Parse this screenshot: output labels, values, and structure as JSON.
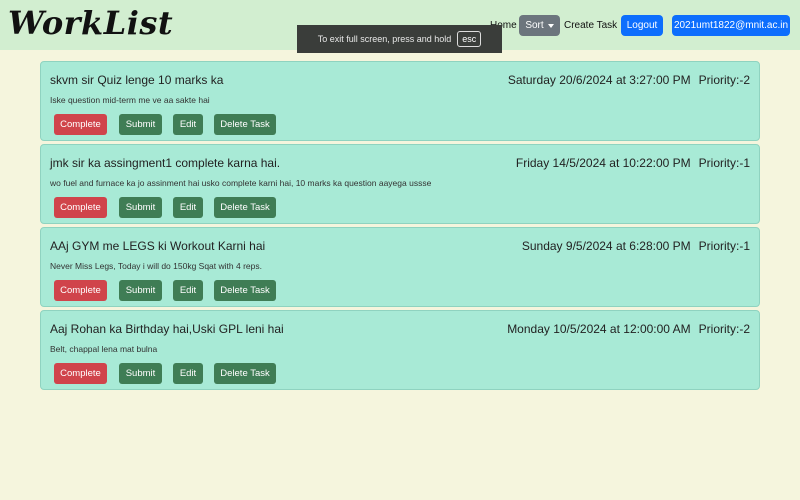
{
  "navbar": {
    "brand": "WorkList",
    "home": "Home",
    "sort": "Sort",
    "create_task": "Create Task",
    "logout": "Logout",
    "user_email": "2021umt1822@mnit.ac.in"
  },
  "fullscreen_notice": {
    "text": "To exit full screen, press and hold",
    "key": "esc"
  },
  "buttons": {
    "complete": "Complete",
    "submit": "Submit",
    "edit": "Edit",
    "delete": "Delete Task"
  },
  "tasks": [
    {
      "title": "skvm sir Quiz lenge 10 marks ka",
      "datetime": "Saturday 20/6/2024 at 3:27:00 PM",
      "priority": "Priority:-2",
      "description": "Iske question mid-term me ve aa sakte hai"
    },
    {
      "title": "jmk sir ka assingment1 complete karna hai.",
      "datetime": "Friday 14/5/2024 at 10:22:00 PM",
      "priority": "Priority:-1",
      "description": "wo fuel and furnace ka jo assinment hai usko complete karni hai, 10 marks ka question aayega ussse"
    },
    {
      "title": "AAj GYM me LEGS ki Workout Karni hai",
      "datetime": "Sunday 9/5/2024 at 6:28:00 PM",
      "priority": "Priority:-1",
      "description": "Never Miss Legs, Today i will do 150kg Sqat with 4 reps."
    },
    {
      "title": "Aaj Rohan ka Birthday hai,Uski GPL leni hai",
      "datetime": "Monday 10/5/2024 at 12:00:00 AM",
      "priority": "Priority:-2",
      "description": "Belt, chappal lena mat bulna"
    }
  ],
  "colors": {
    "page_bg": "#f5f5dd",
    "navbar_bg": "#d2eed0",
    "card_bg": "#a8ead6",
    "complete": "#d0444b",
    "action_green": "#3f7d55",
    "primary_blue": "#0d6efd"
  }
}
